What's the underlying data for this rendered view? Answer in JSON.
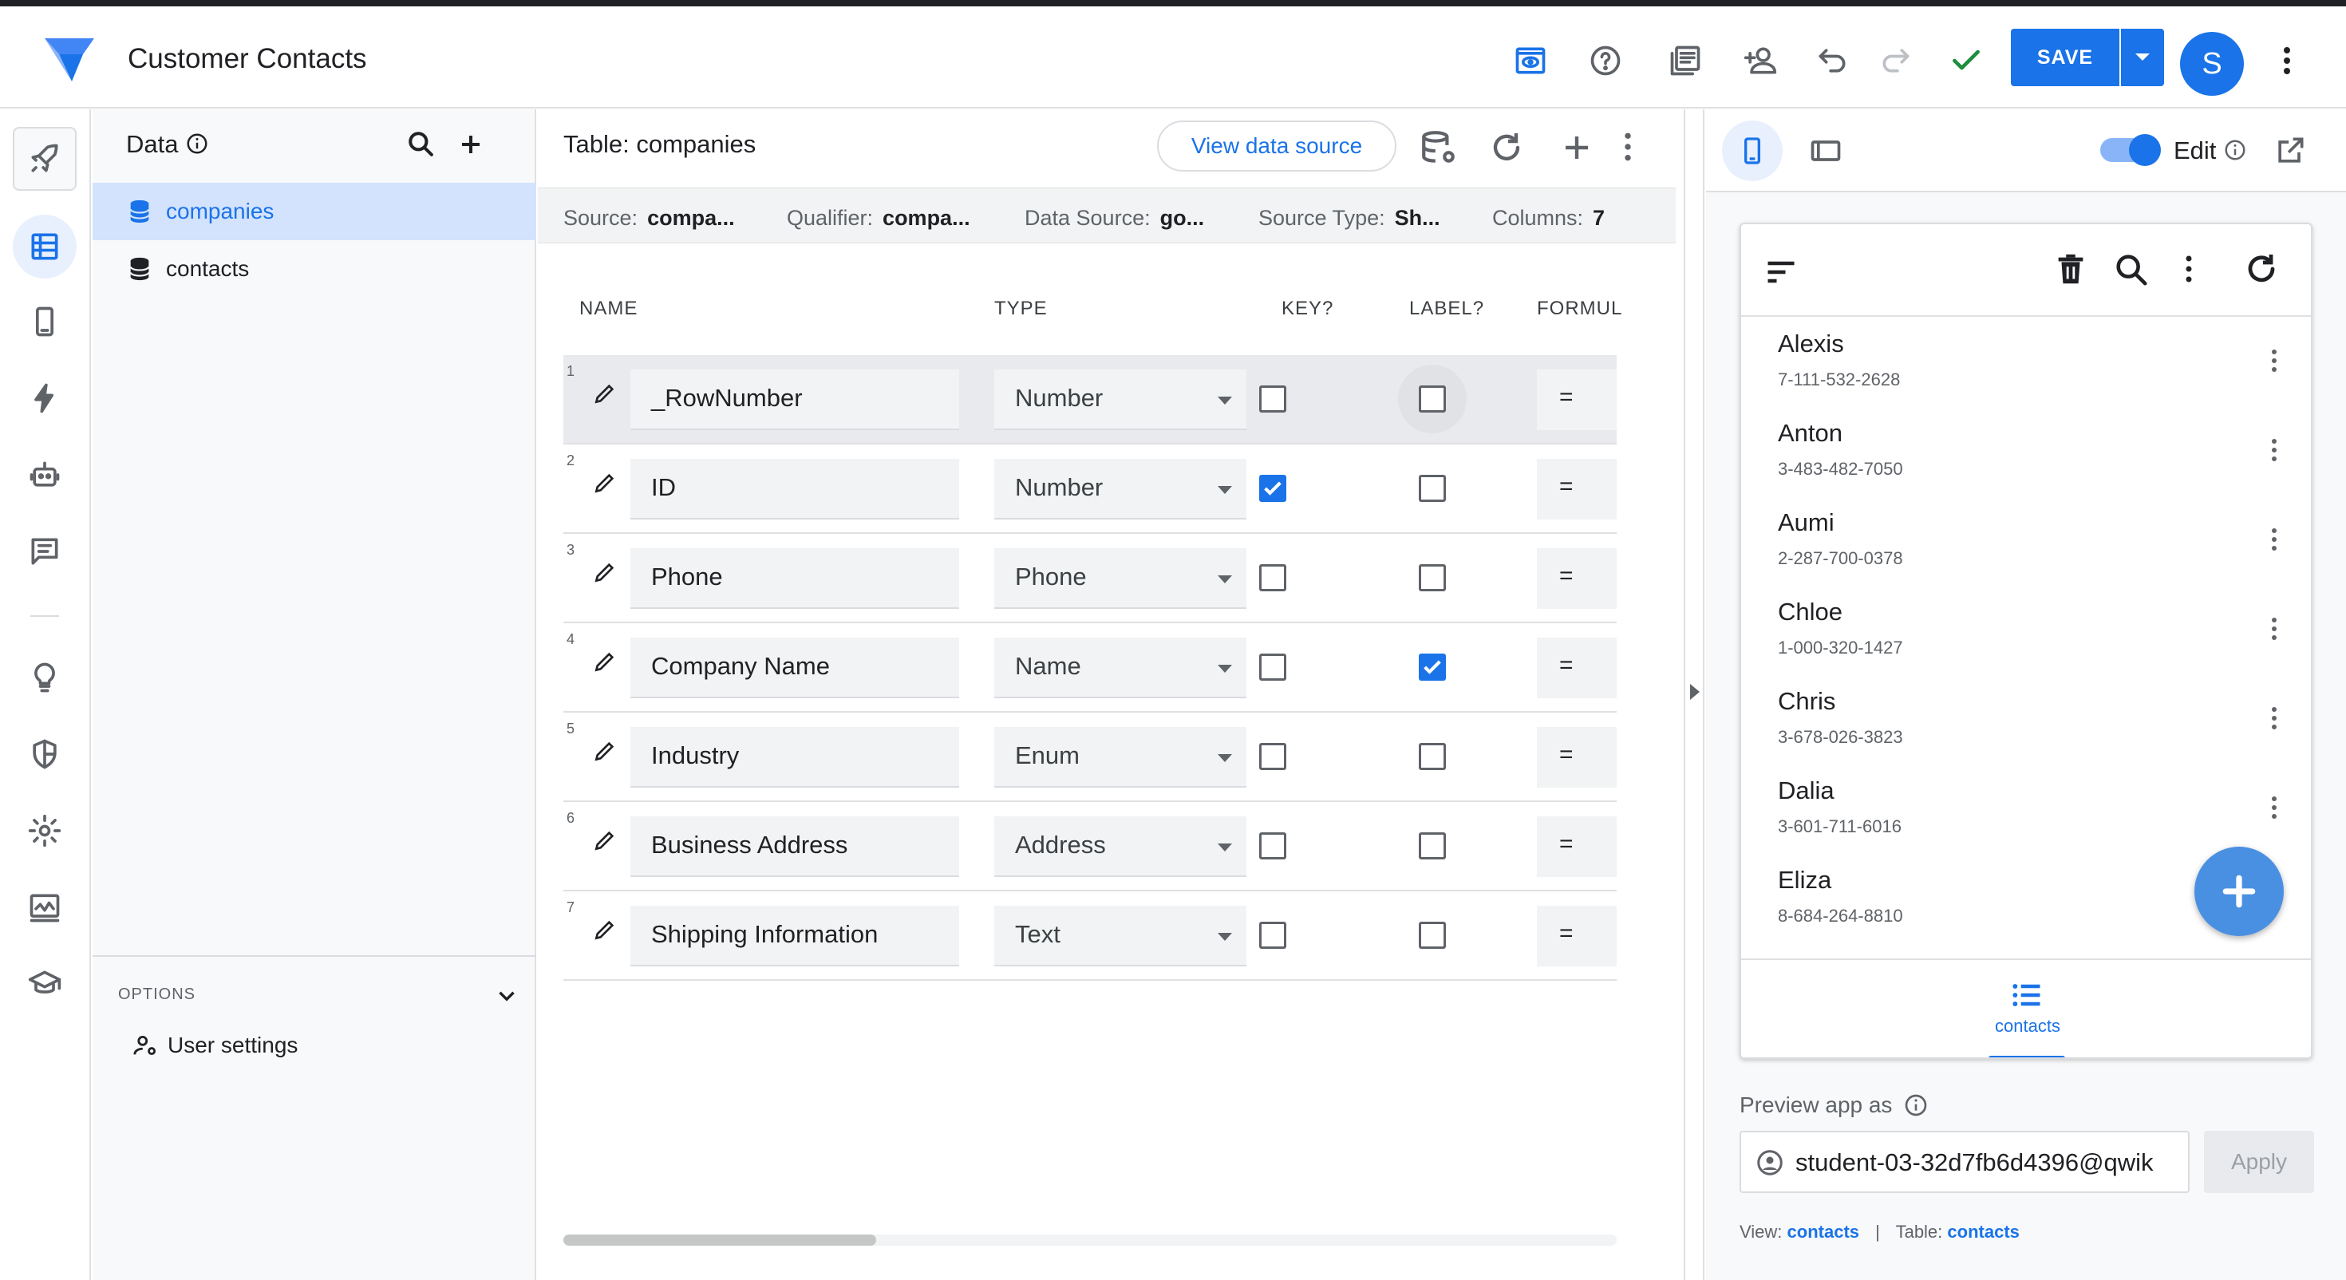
{
  "app": {
    "title": "Customer Contacts",
    "save_label": "SAVE",
    "avatar_initial": "S"
  },
  "toolbar_icons": [
    "preview-icon",
    "help-icon",
    "docs-icon",
    "share-user-icon",
    "undo-icon",
    "redo-icon",
    "check-icon",
    "more-vert-icon"
  ],
  "rail": {
    "items": [
      "rocket-icon",
      "data-icon",
      "phone-icon",
      "bolt-icon",
      "bot-icon",
      "chat-icon",
      "lightbulb-icon",
      "shield-icon",
      "gear-icon",
      "monitor-icon",
      "school-icon"
    ],
    "selected": "data-icon"
  },
  "data_panel": {
    "title": "Data",
    "tables": [
      {
        "label": "companies",
        "selected": true
      },
      {
        "label": "contacts",
        "selected": false
      }
    ],
    "options_label": "OPTIONS",
    "user_settings_label": "User settings"
  },
  "main": {
    "table_title": "Table: companies",
    "view_source_label": "View data source",
    "info": {
      "source_label": "Source:",
      "source_value": "compa...",
      "qualifier_label": "Qualifier:",
      "qualifier_value": "compa...",
      "datasource_label": "Data Source:",
      "datasource_value": "go...",
      "sourcetype_label": "Source Type:",
      "sourcetype_value": "Sh...",
      "columns_label": "Columns:",
      "columns_value": "7"
    },
    "headers": {
      "name": "NAME",
      "type": "TYPE",
      "key": "KEY?",
      "label": "LABEL?",
      "formula": "FORMUL"
    },
    "columns": [
      {
        "num": "1",
        "name": "_RowNumber",
        "type": "Number",
        "key": false,
        "label": false,
        "formula": "="
      },
      {
        "num": "2",
        "name": "ID",
        "type": "Number",
        "key": true,
        "label": false,
        "formula": "="
      },
      {
        "num": "3",
        "name": "Phone",
        "type": "Phone",
        "key": false,
        "label": false,
        "formula": "="
      },
      {
        "num": "4",
        "name": "Company Name",
        "type": "Name",
        "key": false,
        "label": true,
        "formula": "="
      },
      {
        "num": "5",
        "name": "Industry",
        "type": "Enum",
        "key": false,
        "label": false,
        "formula": "="
      },
      {
        "num": "6",
        "name": "Business Address",
        "type": "Address",
        "key": false,
        "label": false,
        "formula": "="
      },
      {
        "num": "7",
        "name": "Shipping Information",
        "type": "Text",
        "key": false,
        "label": false,
        "formula": "="
      }
    ]
  },
  "preview": {
    "edit_label": "Edit",
    "edit_enabled": true,
    "contacts": [
      {
        "name": "Alexis",
        "phone": "7-111-532-2628"
      },
      {
        "name": "Anton",
        "phone": "3-483-482-7050"
      },
      {
        "name": "Aumi",
        "phone": "2-287-700-0378"
      },
      {
        "name": "Chloe",
        "phone": "1-000-320-1427"
      },
      {
        "name": "Chris",
        "phone": "3-678-026-3823"
      },
      {
        "name": "Dalia",
        "phone": "3-601-711-6016"
      },
      {
        "name": "Eliza",
        "phone": "8-684-264-8810"
      }
    ],
    "nav_label": "contacts",
    "preview_as_label": "Preview app as",
    "preview_as_value": "student-03-32d7fb6d4396@qwik",
    "apply_label": "Apply",
    "footer": {
      "view_label": "View:",
      "view_value": "contacts",
      "sep": "|",
      "table_label": "Table:",
      "table_value": "contacts"
    }
  },
  "colors": {
    "accent": "#1a73e8",
    "selected_bg": "#d3e3fd",
    "check_green": "#1e8e3e"
  }
}
